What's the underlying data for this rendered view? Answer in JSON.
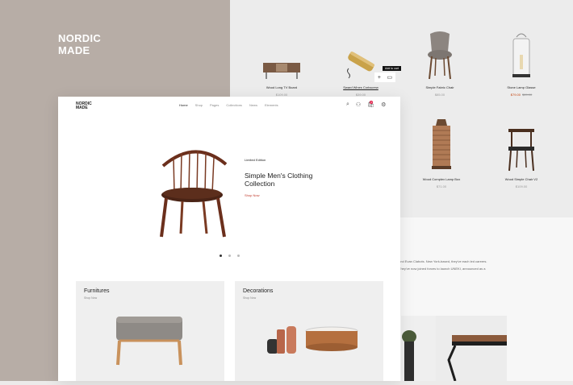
{
  "brand": {
    "line1": "NORDIC",
    "line2": "MADE"
  },
  "back_products_row1": [
    {
      "name": "Wood Long TV Board",
      "price": "$109.00",
      "icon": "tv-board-image"
    },
    {
      "name": "Sward Wines Corkscrew",
      "price": "$39.00",
      "icon": "corkscrew-image"
    },
    {
      "name": "Simple Fabric Chair",
      "price": "$85.00",
      "icon": "fabric-chair-image"
    },
    {
      "name": "Stone Lamp Glasse",
      "price_sale": "$79.00",
      "price_old": "$89.00",
      "icon": "glass-lamp-image"
    }
  ],
  "back_products_row2": [
    {
      "name": "Wood Complex Lamp Box",
      "price": "$71.00",
      "icon": "lamp-box-image"
    },
    {
      "name": "Wood Simple Chair V2",
      "price": "$109.00",
      "icon": "wood-chair-image"
    }
  ],
  "tooltip": "Add to cart",
  "back_text": {
    "line1": "and Evan Clabots. New York-based, they've each led careers.",
    "line2": "They've now joined forces to launch UNEKI, announced as a"
  },
  "front": {
    "logo": {
      "line1": "NORDIC",
      "line2": "MADE"
    },
    "menu": [
      "Home",
      "Shop",
      "Pages",
      "Collections",
      "News",
      "Elements"
    ],
    "hero": {
      "eyebrow": "Limited Edition",
      "title": "Simple Men's Clothing Collection",
      "link": "Shop Now"
    },
    "cart_count": "0",
    "cards": [
      {
        "title": "Furnitures",
        "sub": "Shop Now"
      },
      {
        "title": "Decorations",
        "sub": "Shop Now"
      }
    ]
  },
  "colors": {
    "accent": "#c0392b",
    "left_bg": "#b7ada6",
    "right_bg": "#ececec"
  }
}
